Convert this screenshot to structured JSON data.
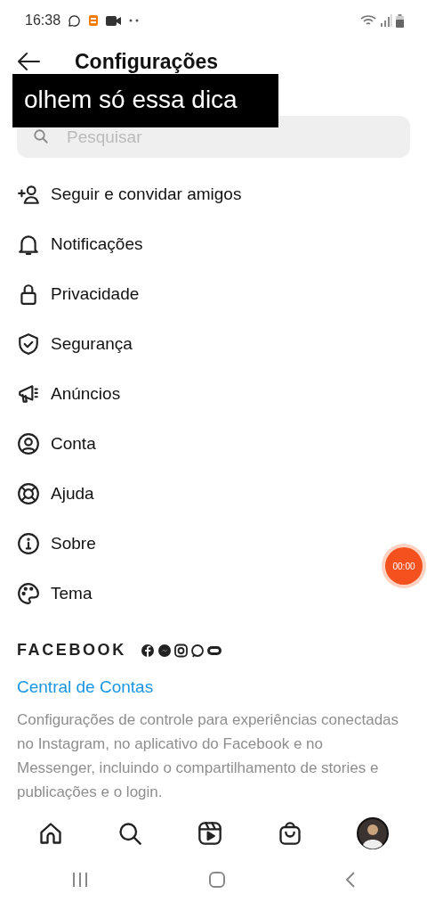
{
  "status_bar": {
    "time": "16:38"
  },
  "header": {
    "title": "Configurações"
  },
  "caption": "olhem só essa dica",
  "search": {
    "placeholder": "Pesquisar"
  },
  "menu": [
    {
      "label": "Seguir e convidar amigos",
      "kind": "invite"
    },
    {
      "label": "Notificações",
      "kind": "notifications"
    },
    {
      "label": "Privacidade",
      "kind": "privacy"
    },
    {
      "label": "Segurança",
      "kind": "security"
    },
    {
      "label": "Anúncios",
      "kind": "ads"
    },
    {
      "label": "Conta",
      "kind": "account"
    },
    {
      "label": "Ajuda",
      "kind": "help"
    },
    {
      "label": "Sobre",
      "kind": "about"
    },
    {
      "label": "Tema",
      "kind": "theme"
    }
  ],
  "facebook": {
    "brand": "FACEBOOK",
    "link": "Central de Contas",
    "description": "Configurações de controle para experiências conectadas no Instagram, no aplicativo do Facebook e no Messenger, incluindo o compartilhamento de stories e publicações e o login."
  },
  "recorder": {
    "time": "00:00"
  },
  "bottom_nav": [
    {
      "kind": "home"
    },
    {
      "kind": "search"
    },
    {
      "kind": "reels"
    },
    {
      "kind": "shop"
    },
    {
      "kind": "profile"
    }
  ]
}
